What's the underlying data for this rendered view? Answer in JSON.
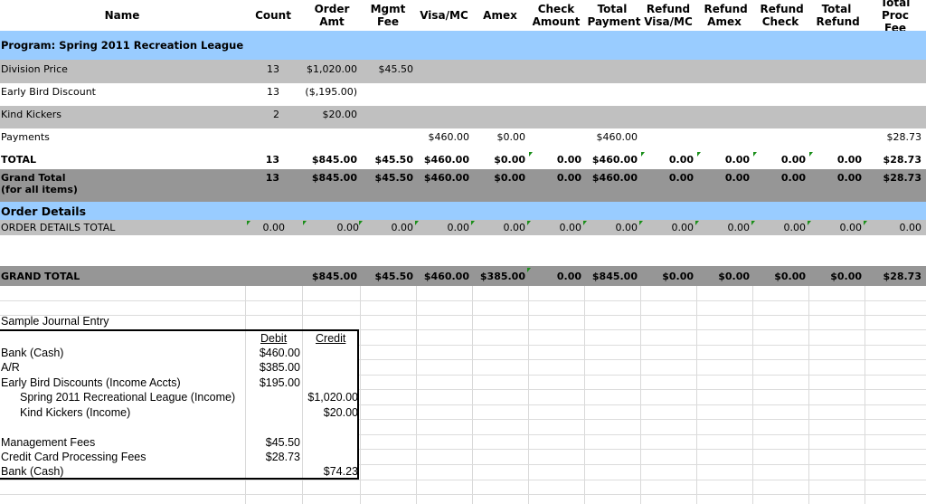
{
  "headers": [
    "Name",
    "Count",
    "Order Amt",
    "Mgmt Fee",
    "Visa/MC",
    "Amex",
    "Check Amount",
    "Total Payment",
    "Refund Visa/MC",
    "Refund Amex",
    "Refund Check",
    "Total Refund",
    "Total Proc Fee"
  ],
  "program_title": "Program: Spring 2011 Recreation League",
  "rows": [
    {
      "name": "Division Price",
      "count": "13",
      "order": "$1,020.00",
      "mgmt": "$45.50"
    },
    {
      "name": "Early Bird Discount",
      "count": "13",
      "order": "($,195.00)"
    },
    {
      "name": "Kind Kickers",
      "count": "2",
      "order": "$20.00"
    },
    {
      "name": "Payments",
      "visa": "$460.00",
      "amex": "$0.00",
      "total_payment": "$460.00",
      "proc_fee": "$28.73"
    }
  ],
  "total": {
    "name": "TOTAL",
    "count": "13",
    "order": "$845.00",
    "mgmt": "$45.50",
    "visa": "$460.00",
    "amex": "$0.00",
    "check": "0.00",
    "total_payment": "$460.00",
    "refund_visa": "0.00",
    "refund_amex": "0.00",
    "refund_check": "0.00",
    "total_refund": "0.00",
    "proc_fee": "$28.73"
  },
  "grand_total_items": {
    "name_line1": "Grand Total",
    "name_line2": "(for all items)",
    "count": "13",
    "order": "$845.00",
    "mgmt": "$45.50",
    "visa": "$460.00",
    "amex": "$0.00",
    "check": "0.00",
    "total_payment": "$460.00",
    "refund_visa": "0.00",
    "refund_amex": "0.00",
    "refund_check": "0.00",
    "total_refund": "0.00",
    "proc_fee": "$28.73"
  },
  "order_details_title": "Order Details",
  "order_details_total": {
    "name": "ORDER DETAILS TOTAL",
    "values": [
      "0.00",
      "0.00",
      "0.00",
      "0.00",
      "0.00",
      "0.00",
      "0.00",
      "0.00",
      "0.00",
      "0.00",
      "0.00",
      "0.00"
    ]
  },
  "grand_total": {
    "name": "GRAND TOTAL",
    "order": "$845.00",
    "mgmt": "$45.50",
    "visa": "$460.00",
    "amex": "$385.00",
    "check": "0.00",
    "total_payment": "$845.00",
    "refund_visa": "$0.00",
    "refund_amex": "$0.00",
    "refund_check": "$0.00",
    "total_refund": "$0.00",
    "proc_fee": "$28.73"
  },
  "journal": {
    "title": "Sample Journal Entry",
    "debit_label": "Debit",
    "credit_label": "Credit",
    "lines": [
      {
        "account": "Bank (Cash)",
        "debit": "$460.00",
        "credit": ""
      },
      {
        "account": "A/R",
        "debit": "$385.00",
        "credit": ""
      },
      {
        "account": "Early Bird Discounts (Income Accts)",
        "debit": "$195.00",
        "credit": ""
      },
      {
        "account": "Spring 2011 Recreational League (Income)",
        "debit": "",
        "credit": "$1,020.00"
      },
      {
        "account": "Kind Kickers (Income)",
        "debit": "",
        "credit": "$20.00"
      },
      {
        "account": "",
        "debit": "",
        "credit": ""
      },
      {
        "account": "Management Fees",
        "debit": "$45.50",
        "credit": ""
      },
      {
        "account": "Credit Card Processing Fees",
        "debit": "$28.73",
        "credit": ""
      },
      {
        "account": "Bank (Cash)",
        "debit": "",
        "credit": "$74.23"
      }
    ]
  },
  "colors": {
    "header_bg": "#ffffff",
    "program_bg": "#99ccff",
    "gray_row": "#c0c0c0",
    "dark_gray": "#969696",
    "flag_green": "#1a8f1a"
  }
}
